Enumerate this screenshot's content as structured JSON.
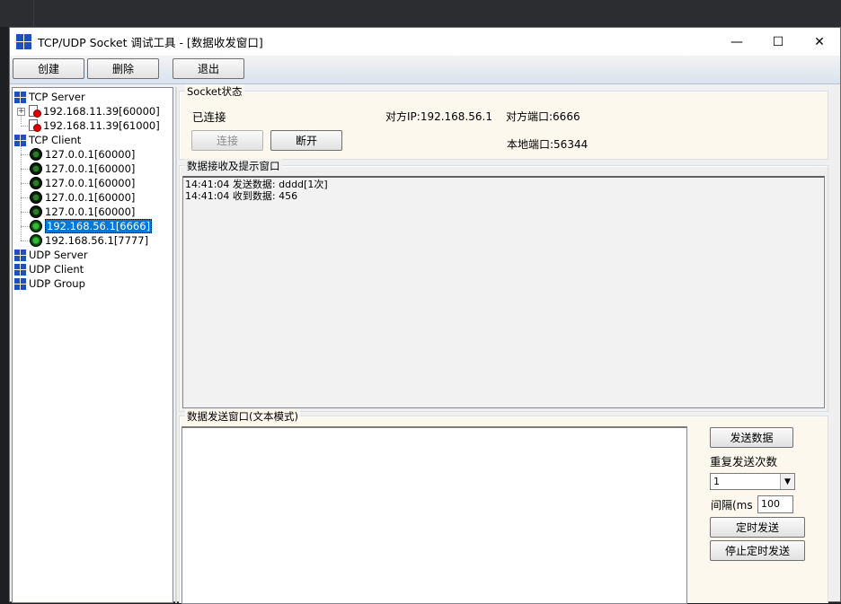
{
  "window": {
    "title": "TCP/UDP Socket 调试工具 - [数据收发窗口]",
    "controls": {
      "minimize": "—",
      "maximize": "☐",
      "close": "✕"
    }
  },
  "toolbar": {
    "create_label": "创建",
    "delete_label": "删除",
    "exit_label": "退出"
  },
  "tree": {
    "tcp_server": {
      "label": "TCP Server",
      "children": [
        "192.168.11.39[60000]",
        "192.168.11.39[61000]"
      ]
    },
    "tcp_client": {
      "label": "TCP Client",
      "children": [
        "127.0.0.1[60000]",
        "127.0.0.1[60000]",
        "127.0.0.1[60000]",
        "127.0.0.1[60000]",
        "127.0.0.1[60000]",
        "192.168.56.1[6666]",
        "192.168.56.1[7777]"
      ],
      "selected_index": 5
    },
    "udp_server": {
      "label": "UDP Server"
    },
    "udp_client": {
      "label": "UDP Client"
    },
    "udp_group": {
      "label": "UDP Group"
    }
  },
  "socket_status": {
    "title": "Socket状态",
    "state": "已连接",
    "remote_ip": "对方IP:192.168.56.1",
    "remote_port": "对方端口:6666",
    "local_port": "本地端口:56344",
    "connect_label": "连接",
    "disconnect_label": "断开"
  },
  "receive": {
    "title": "数据接收及提示窗口",
    "lines": [
      "14:41:04 发送数据: dddd[1次]",
      "14:41:04 收到数据: 456"
    ]
  },
  "send": {
    "title": "数据发送窗口(文本模式)",
    "text": "",
    "send_label": "发送数据",
    "repeat_label": "重复发送次数",
    "repeat_value": "1",
    "interval_label": "间隔(ms",
    "interval_value": "100",
    "timed_send_label": "定时发送",
    "stop_timed_label": "停止定时发送"
  },
  "colors": {
    "accent": "#0078d7",
    "panel_bg": "#fcf8ee",
    "icon_blue": "#1f4fbf"
  }
}
